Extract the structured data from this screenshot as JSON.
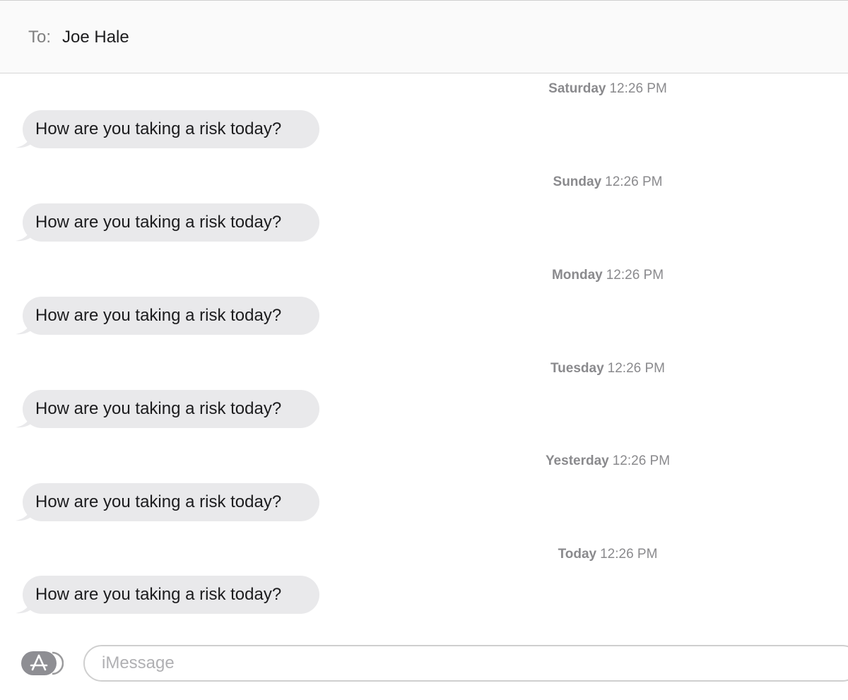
{
  "header": {
    "to_label": "To:",
    "recipient": "Joe Hale"
  },
  "conversation": [
    {
      "day": "Saturday",
      "time": "12:26 PM",
      "message": "How are you taking a risk today?"
    },
    {
      "day": "Sunday",
      "time": "12:26 PM",
      "message": "How are you taking a risk today?"
    },
    {
      "day": "Monday",
      "time": "12:26 PM",
      "message": "How are you taking a risk today?"
    },
    {
      "day": "Tuesday",
      "time": "12:26 PM",
      "message": "How are you taking a risk today?"
    },
    {
      "day": "Yesterday",
      "time": "12:26 PM",
      "message": "How are you taking a risk today?"
    },
    {
      "day": "Today",
      "time": "12:26 PM",
      "message": "How are you taking a risk today?"
    }
  ],
  "compose": {
    "placeholder": "iMessage",
    "value": "",
    "apps_icon": "app-store-icon"
  },
  "colors": {
    "bubble_incoming": "#e9e9eb",
    "timestamp": "#8a8a8d",
    "header_bg": "#fafafa"
  }
}
